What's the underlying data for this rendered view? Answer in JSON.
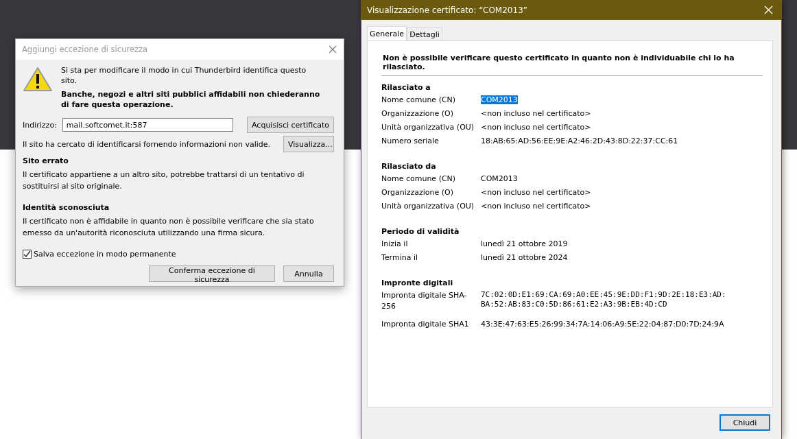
{
  "exception_dialog": {
    "title": "Aggiungi eccezione di sicurezza",
    "intro": "Si sta per modificare il modo in cui Thunderbird identifica questo sito.",
    "warning": "Banche, negozi e altri siti pubblici affidabili non chiederanno di fare questa operazione.",
    "address_label": "Indirizzo:",
    "address_value": "mail.softcomet.it:587",
    "get_certificate_button": "Acquisisci certificato",
    "status": "Il sito ha cercato di identificarsi fornendo informazioni non valide.",
    "view_button": "Visualizza...",
    "problems": [
      {
        "heading": "Sito errato",
        "text": "Il certificato appartiene a un altro sito, potrebbe trattarsi di un tentativo di sostituirsi al sito originale."
      },
      {
        "heading": "Identità sconosciuta",
        "text": "Il certificato non è affidabile in quanto non è possibile verificare che sia stato emesso da un'autorità riconosciuta utilizzando una firma sicura."
      }
    ],
    "permanent": {
      "label": "Salva eccezione in modo permanente",
      "checked": true
    },
    "confirm_button": "Conferma eccezione di sicurezza",
    "cancel_button": "Annulla"
  },
  "certificate_viewer": {
    "title": "Visualizzazione certificato: “COM2013”",
    "tabs": [
      {
        "label": "Generale",
        "selected": true
      },
      {
        "label": "Dettagli",
        "selected": false
      }
    ],
    "notice": "Non è possibile verificare questo certificato in quanto non è individuabile chi lo ha rilasciato.",
    "sections": [
      {
        "heading": "Rilasciato a",
        "fields": [
          {
            "label": "Nome comune (CN)",
            "value": "COM2013",
            "selected": true
          },
          {
            "label": "Organizzazione (O)",
            "value": "<non incluso nel certificato>",
            "selected": false
          },
          {
            "label": "Unità organizzativa (OU)",
            "value": "<non incluso nel certificato>",
            "selected": false
          },
          {
            "label": "Numero seriale",
            "value": "18:AB:65:AD:56:EE:9E:A2:46:2D:43:8D:22:37:CC:61",
            "selected": false
          }
        ]
      },
      {
        "heading": "Rilasciato da",
        "fields": [
          {
            "label": "Nome comune (CN)",
            "value": "COM2013",
            "selected": false
          },
          {
            "label": "Organizzazione (O)",
            "value": "<non incluso nel certificato>",
            "selected": false
          },
          {
            "label": "Unità organizzativa (OU)",
            "value": "<non incluso nel certificato>",
            "selected": false
          }
        ]
      },
      {
        "heading": "Periodo di validità",
        "fields": [
          {
            "label": "Inizia il",
            "value": "lunedì 21 ottobre 2019",
            "selected": false
          },
          {
            "label": "Termina il",
            "value": "lunedì 21 ottobre 2024",
            "selected": false
          }
        ]
      },
      {
        "heading": "Impronte digitali",
        "fields": [
          {
            "label": "Impronta digitale SHA-256",
            "value": "7C:02:0D:E1:69:CA:69:A0:EE:45:9E:DD:F1:9D:2E:18:E3:AD:BA:52:AB:83:C0:5D:86:61:E2:A3:9B:EB:4D:CD",
            "kind": "mono",
            "selected": false
          },
          {
            "label": "Impronta digitale SHA1",
            "value": "43:3E:47:63:E5:26:99:34:7A:14:06:A9:5E:22:04:87:D0:7D:24:9A",
            "selected": false
          }
        ]
      }
    ],
    "close_button": "Chiudi"
  }
}
